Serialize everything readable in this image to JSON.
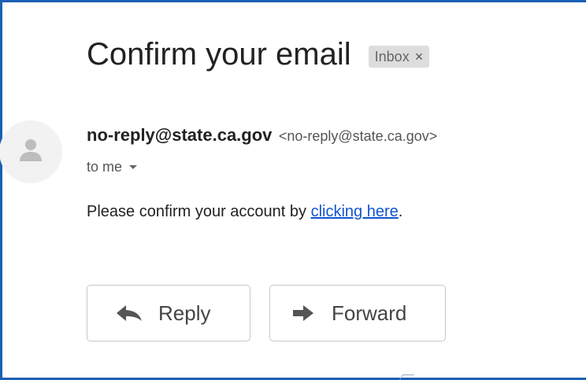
{
  "email": {
    "subject": "Confirm your email",
    "label": "Inbox",
    "label_close": "×",
    "sender_name": "no-reply@state.ca.gov",
    "sender_email": "<no-reply@state.ca.gov>",
    "recipient": "to me",
    "body_prefix": "Please confirm your account by ",
    "body_link": "clicking here",
    "body_suffix": "."
  },
  "actions": {
    "reply_label": "Reply",
    "forward_label": "Forward"
  },
  "icons": {
    "avatar": "person-icon",
    "reply": "reply-arrow-icon",
    "forward": "forward-arrow-icon",
    "dropdown": "caret-down-icon"
  },
  "colors": {
    "frame_border": "#1a5fb4",
    "link": "#1155cc",
    "chip_bg": "#dddddd"
  }
}
